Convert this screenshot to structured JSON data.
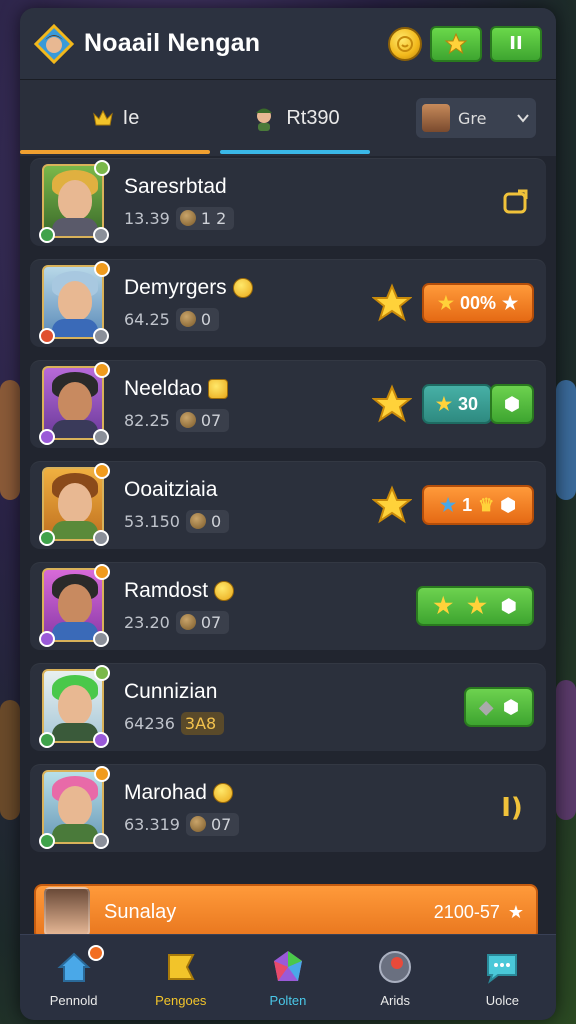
{
  "header": {
    "title": "Noaail Nengan",
    "btn_star_icon": "star-icon",
    "btn_pause_label": "II"
  },
  "tabs": [
    {
      "label": "Ie",
      "icon": "crown-icon"
    },
    {
      "label": "Rt390",
      "icon": "character-icon"
    }
  ],
  "dropdown": {
    "label": "Gre"
  },
  "rows": [
    {
      "name": "Saresrbtad",
      "score": "13.39",
      "pill": "1 2",
      "right_type": "icon",
      "right_text": "⟲"
    },
    {
      "name": "Demyrgers",
      "score": "64.25",
      "pill": "0",
      "right_type": "star-orange",
      "right_text": "00%"
    },
    {
      "name": "Neeldao",
      "score": "82.25",
      "pill": "07",
      "right_type": "star-teal",
      "right_text": "30"
    },
    {
      "name": "Ooaitziaia",
      "score": "53.150",
      "pill": "0",
      "right_type": "star-orange2",
      "right_text": "1"
    },
    {
      "name": "Ramdost",
      "score": "23.20",
      "pill": "07",
      "right_type": "green-stars",
      "right_text": ""
    },
    {
      "name": "Cunnizian",
      "score": "64236",
      "pill": "3A8",
      "right_type": "green-small",
      "right_text": ""
    },
    {
      "name": "Marohad",
      "score": "63.319",
      "pill": "07",
      "right_type": "bracket",
      "right_text": "I)"
    }
  ],
  "banner": {
    "name": "Sunalay",
    "score": "2100-57"
  },
  "nav": [
    {
      "label": "Pennold",
      "icon": "home-icon"
    },
    {
      "label": "Pengoes",
      "icon": "flag-icon"
    },
    {
      "label": "Polten",
      "icon": "gem-icon"
    },
    {
      "label": "Arids",
      "icon": "record-icon"
    },
    {
      "label": "Uolce",
      "icon": "chat-icon"
    }
  ],
  "colors": {
    "tab1_underline": "#f0a030",
    "tab2_underline": "#3ab8e8",
    "accent_green": "#3ea530",
    "accent_orange": "#e56a14"
  }
}
